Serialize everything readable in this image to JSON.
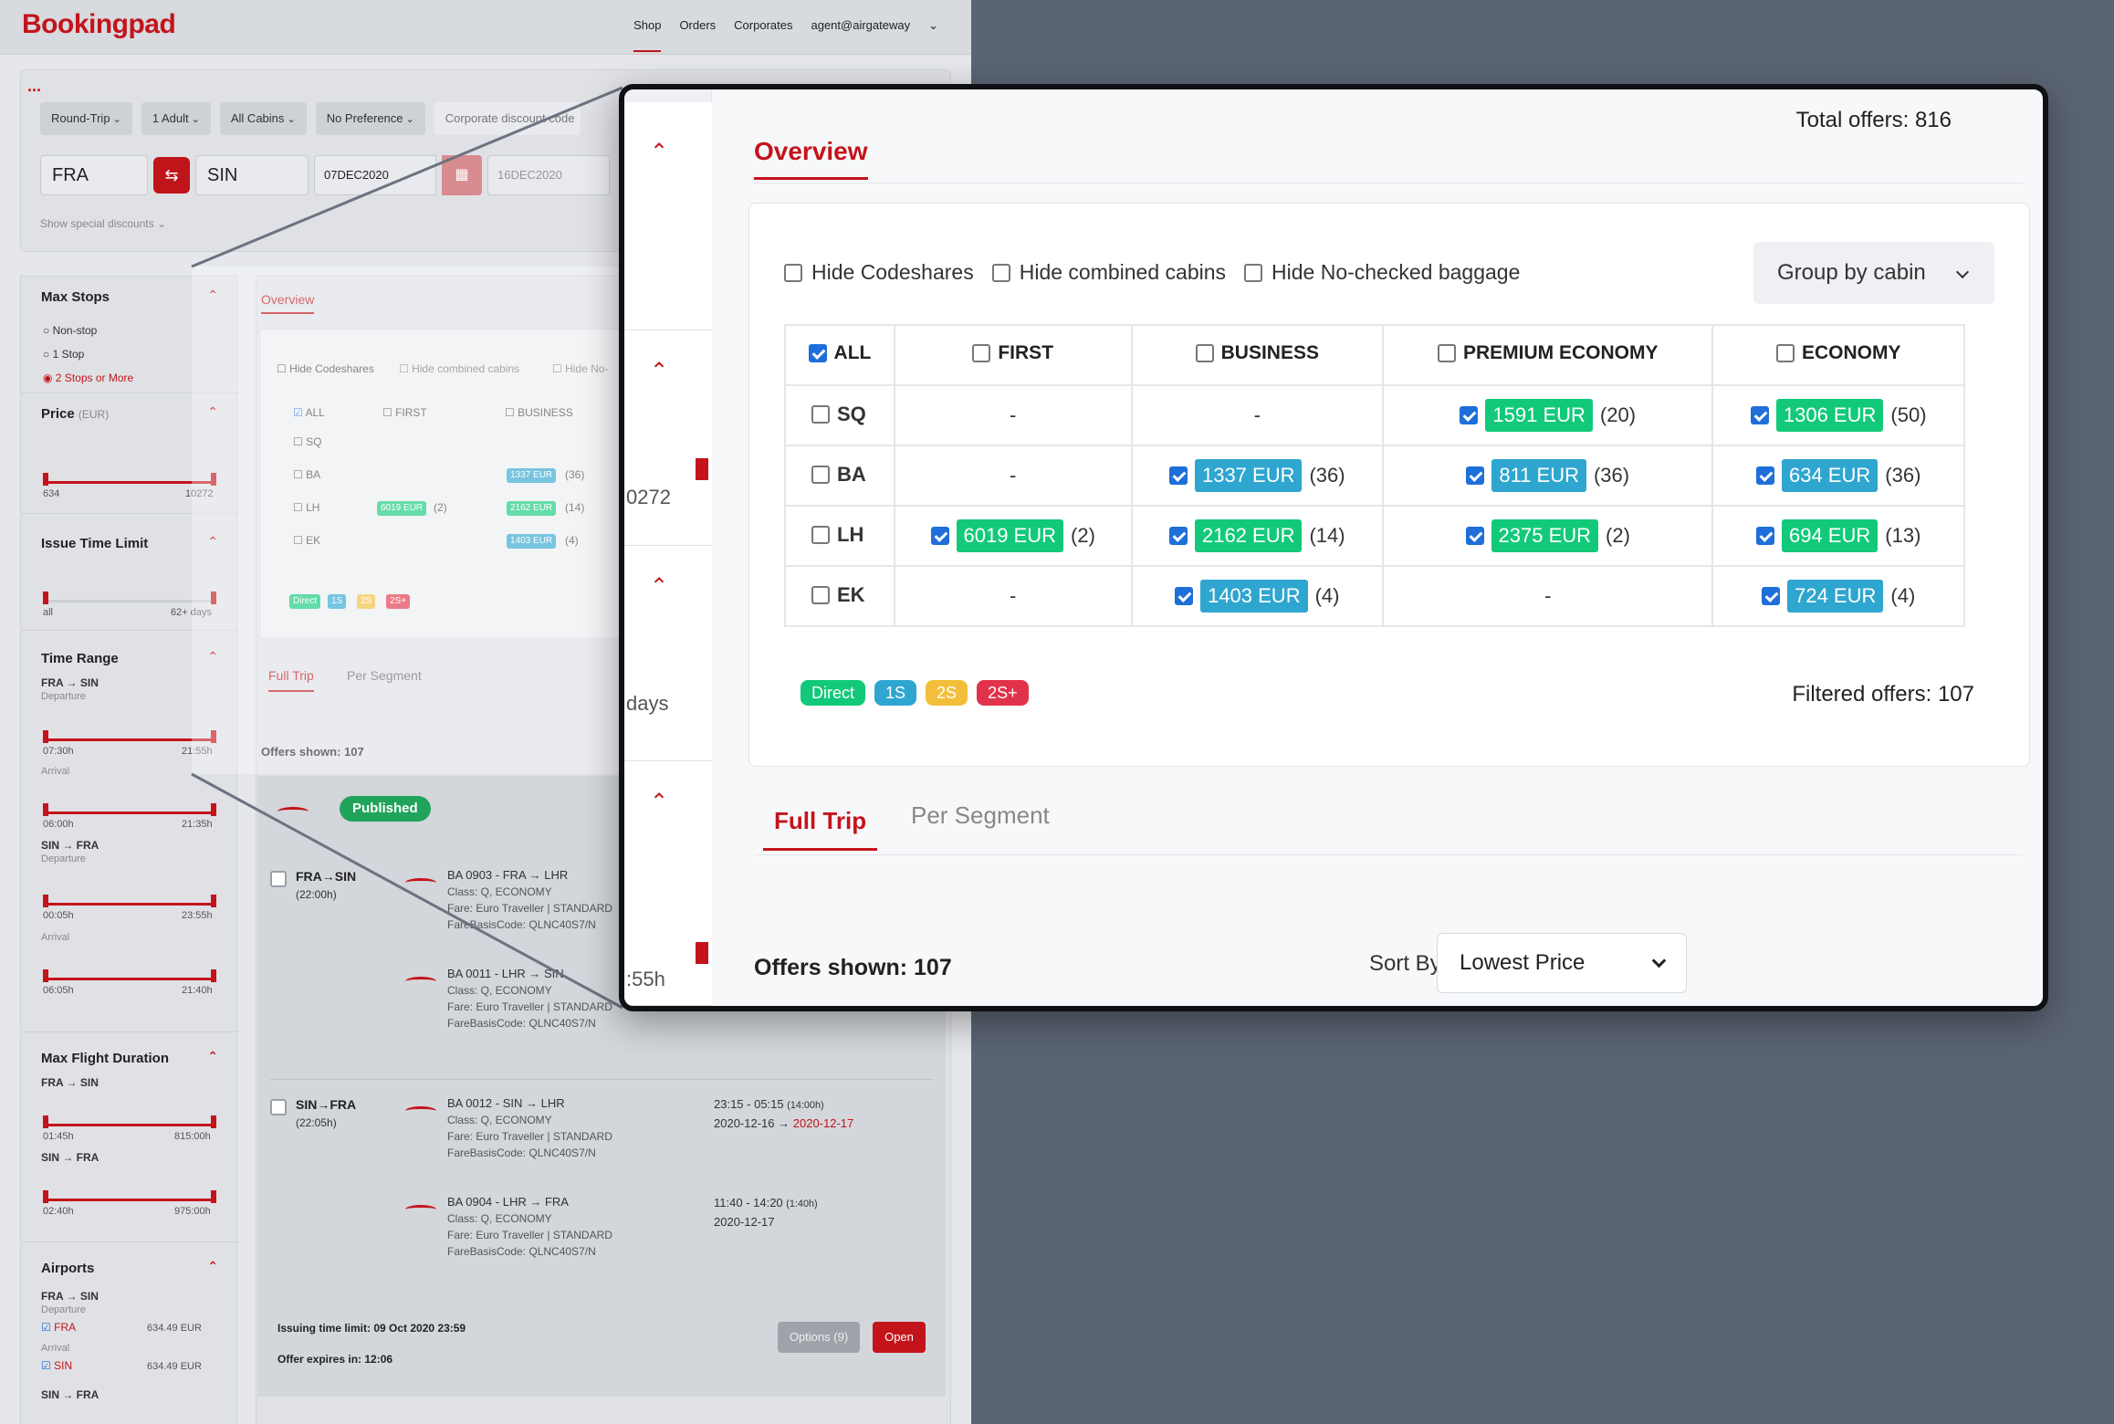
{
  "app": {
    "brand": "Bookingpad",
    "nav": [
      "Shop",
      "Orders",
      "Corporates",
      "agent@airgateway"
    ],
    "search": {
      "dots": "...",
      "chips": [
        "Round-Trip",
        "1 Adult",
        "All Cabins",
        "No Preference"
      ],
      "corporate_placeholder": "Corporate discount code",
      "from": "FRA",
      "to": "SIN",
      "depart_date": "07DEC2020",
      "return_date": "16DEC2020",
      "special": "Show special discounts"
    },
    "filters": {
      "max_stops": {
        "title": "Max Stops",
        "options": [
          "Non-stop",
          "1 Stop",
          "2 Stops or More"
        ],
        "selected": "2 Stops or More"
      },
      "price": {
        "title": "Price",
        "unit": "(EUR)",
        "min": "634",
        "max": "10272"
      },
      "issue_time": {
        "title": "Issue Time Limit",
        "min": "all",
        "max": "62+ days"
      },
      "time_range": {
        "title": "Time Range",
        "out": "FRA → SIN",
        "in": "SIN → FRA",
        "departure": "Departure",
        "arrival": "Arrival",
        "out_dep": [
          "07:30h",
          "21:55h"
        ],
        "out_arr": [
          "06:00h",
          "21:35h"
        ],
        "in_dep": [
          "00:05h",
          "23:55h"
        ],
        "in_arr": [
          "06:05h",
          "21:40h"
        ]
      },
      "max_duration": {
        "title": "Max Flight Duration",
        "out": "FRA → SIN",
        "in": "SIN → FRA",
        "out_range": [
          "01:45h",
          "815:00h"
        ],
        "in_range": [
          "02:40h",
          "975:00h"
        ]
      },
      "airports": {
        "title": "Airports",
        "out": "FRA → SIN",
        "departure": "Departure",
        "arrival": "Arrival",
        "dep_code": "FRA",
        "dep_price": "634.49 EUR",
        "arr_code": "SIN",
        "arr_price": "634.49 EUR",
        "in": "SIN → FRA"
      }
    },
    "mini": {
      "overview": "Overview",
      "hide": [
        "Hide Codeshares",
        "Hide combined cabins",
        "Hide No-"
      ],
      "cols": [
        "ALL",
        "FIRST",
        "BUSINESS"
      ],
      "rows": [
        "SQ",
        "BA",
        "LH",
        "EK"
      ],
      "cells": {
        "ba_bus": "1337 EUR",
        "ba_bus_c": "(36)",
        "lh_first": "6019 EUR",
        "lh_first_c": "(2)",
        "lh_bus": "2162 EUR",
        "lh_bus_c": "(14)",
        "ek_bus": "1403 EUR",
        "ek_bus_c": "(4)"
      },
      "badges": [
        "Direct",
        "1S",
        "2S",
        "2S+"
      ],
      "tabs": [
        "Full Trip",
        "Per Segment"
      ],
      "shown": "Offers shown: 107"
    },
    "offer": {
      "status": "Published",
      "out_leg": {
        "route": "FRA→SIN",
        "duration": "(22:00h)"
      },
      "in_leg": {
        "route": "SIN→FRA",
        "duration": "(22:05h)"
      },
      "segments": [
        {
          "flight": "BA 0903 - FRA → LHR",
          "class": "Class: Q, ECONOMY",
          "fare": "Fare: Euro Traveller | STANDARD",
          "basis": "FareBasisCode: QLNC40S7/N"
        },
        {
          "flight": "BA 0011 - LHR → SIN",
          "class": "Class: Q, ECONOMY",
          "fare": "Fare: Euro Traveller | STANDARD",
          "basis": "FareBasisCode: QLNC40S7/N"
        },
        {
          "flight": "BA 0012 - SIN → LHR",
          "class": "Class: Q, ECONOMY",
          "fare": "Fare: Euro Traveller | STANDARD",
          "basis": "FareBasisCode: QLNC40S7/N",
          "time": "23:15 - 05:15",
          "dur": "(14:00h)",
          "date1": "2020-12-16 →",
          "date2": "2020-12-17"
        },
        {
          "flight": "BA 0904 - LHR → FRA",
          "class": "Class: Q, ECONOMY",
          "fare": "Fare: Euro Traveller | STANDARD",
          "basis": "FareBasisCode: QLNC40S7/N",
          "time": "11:40 - 14:20",
          "dur": "(1:40h)",
          "date1": "2020-12-17"
        }
      ],
      "issuing": "Issuing time limit: 09 Oct 2020 23:59",
      "expires": "Offer expires in: 12:06",
      "options_btn": "Options (9)",
      "open_btn": "Open"
    }
  },
  "zoom": {
    "total": "Total offers: 816",
    "overview": "Overview",
    "hide": [
      "Hide Codeshares",
      "Hide combined cabins",
      "Hide No-checked baggage"
    ],
    "group_by": "Group by cabin",
    "columns": [
      "ALL",
      "FIRST",
      "BUSINESS",
      "PREMIUM ECONOMY",
      "ECONOMY"
    ],
    "rows": [
      {
        "code": "SQ",
        "cells": [
          {
            "dash": "-"
          },
          {
            "dash": "-"
          },
          {
            "price": "1591 EUR",
            "count": "(20)",
            "color": "green"
          },
          {
            "price": "1306 EUR",
            "count": "(50)",
            "color": "green"
          }
        ]
      },
      {
        "code": "BA",
        "cells": [
          {
            "dash": "-"
          },
          {
            "price": "1337 EUR",
            "count": "(36)",
            "color": "blue"
          },
          {
            "price": "811 EUR",
            "count": "(36)",
            "color": "blue"
          },
          {
            "price": "634 EUR",
            "count": "(36)",
            "color": "blue"
          }
        ]
      },
      {
        "code": "LH",
        "cells": [
          {
            "price": "6019 EUR",
            "count": "(2)",
            "color": "green"
          },
          {
            "price": "2162 EUR",
            "count": "(14)",
            "color": "green"
          },
          {
            "price": "2375 EUR",
            "count": "(2)",
            "color": "green"
          },
          {
            "price": "694 EUR",
            "count": "(13)",
            "color": "green"
          }
        ]
      },
      {
        "code": "EK",
        "cells": [
          {
            "dash": "-"
          },
          {
            "price": "1403 EUR",
            "count": "(4)",
            "color": "blue"
          },
          {
            "dash": "-"
          },
          {
            "price": "724 EUR",
            "count": "(4)",
            "color": "blue"
          }
        ]
      }
    ],
    "badges": [
      {
        "label": "Direct",
        "color": "#12c97a"
      },
      {
        "label": "1S",
        "color": "#2fa6cf"
      },
      {
        "label": "2S",
        "color": "#f3bf3a"
      },
      {
        "label": "2S+",
        "color": "#e0334b"
      }
    ],
    "filtered": "Filtered offers: 107",
    "tabs": [
      "Full Trip",
      "Per Segment"
    ],
    "shown": "Offers shown: 107",
    "sort_label": "Sort By:",
    "sort_value": "Lowest Price",
    "side_labels": [
      "0272",
      "days",
      ":55h"
    ]
  },
  "colors": {
    "brand_red": "#c4141b",
    "green": "#12c97a",
    "blue": "#2fa6cf",
    "backdrop": "#5b6474"
  }
}
